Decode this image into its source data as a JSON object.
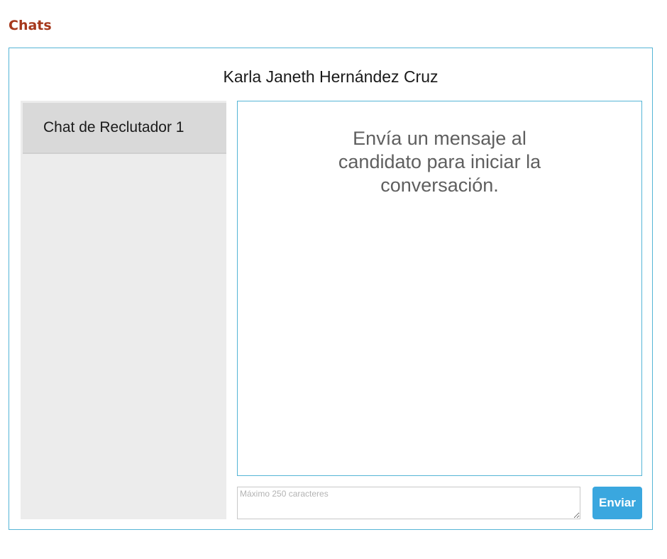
{
  "page": {
    "heading": "Chats"
  },
  "chat": {
    "candidate_name": "Karla Janeth Hernández Cruz",
    "sidebar": {
      "items": [
        {
          "label": "Chat de Reclutador 1",
          "selected": true
        }
      ]
    },
    "empty_state_text": "Envía un mensaje al candidato para iniciar la conversación.",
    "input": {
      "value": "",
      "placeholder": "Máximo 250 caracteres"
    },
    "send_label": "Enviar"
  },
  "colors": {
    "heading": "#a6381c",
    "panel_border": "#55b5d6",
    "send_button": "#3aa7df",
    "sidebar_bg": "#ececec",
    "sidebar_selected": "#d9d9d9"
  }
}
